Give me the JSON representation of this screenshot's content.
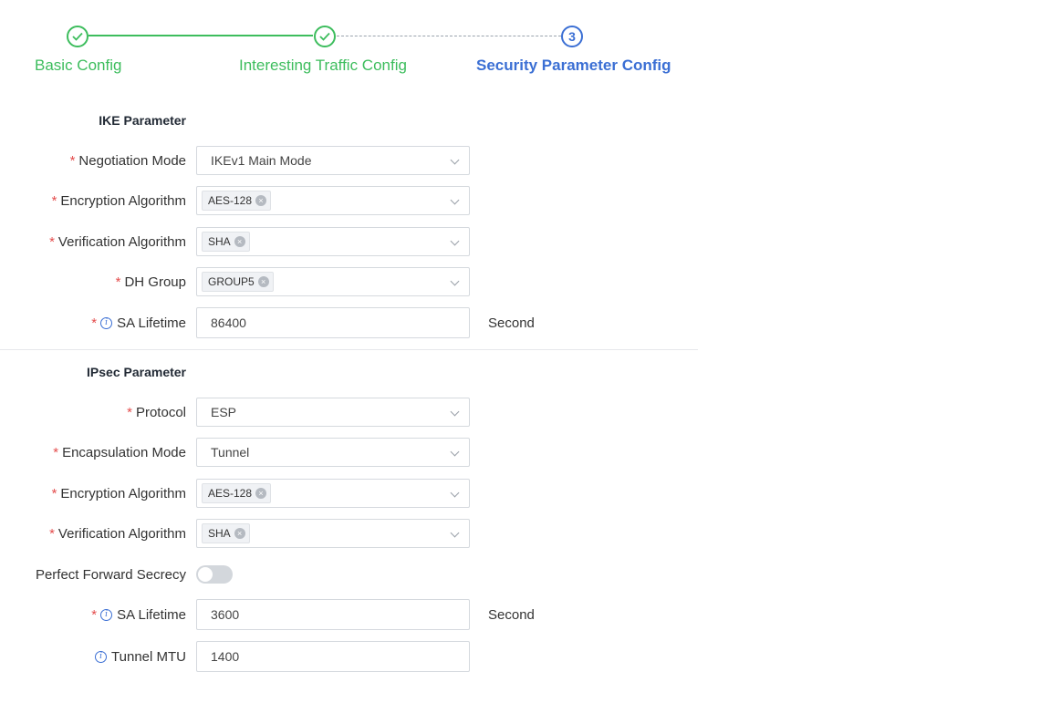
{
  "stepper": {
    "steps": [
      {
        "label": "Basic Config",
        "state": "done"
      },
      {
        "label": "Interesting Traffic Config",
        "state": "done"
      },
      {
        "label": "Security Parameter Config",
        "state": "active",
        "number": "3"
      }
    ]
  },
  "ike": {
    "title": "IKE Parameter",
    "negotiation_mode": {
      "label": "Negotiation Mode",
      "value": "IKEv1 Main Mode"
    },
    "encryption": {
      "label": "Encryption Algorithm",
      "tag": "AES-128"
    },
    "verification": {
      "label": "Verification Algorithm",
      "tag": "SHA"
    },
    "dh_group": {
      "label": "DH Group",
      "tag": "GROUP5"
    },
    "sa_lifetime": {
      "label": "SA Lifetime",
      "value": "86400",
      "unit": "Second"
    }
  },
  "ipsec": {
    "title": "IPsec Parameter",
    "protocol": {
      "label": "Protocol",
      "value": "ESP"
    },
    "encapsulation": {
      "label": "Encapsulation Mode",
      "value": "Tunnel"
    },
    "encryption": {
      "label": "Encryption Algorithm",
      "tag": "AES-128"
    },
    "verification": {
      "label": "Verification Algorithm",
      "tag": "SHA"
    },
    "pfs": {
      "label": "Perfect Forward Secrecy",
      "enabled": false
    },
    "sa_lifetime": {
      "label": "SA Lifetime",
      "value": "3600",
      "unit": "Second"
    },
    "tunnel_mtu": {
      "label": "Tunnel MTU",
      "value": "1400"
    }
  },
  "colors": {
    "done": "#3dbd5d",
    "active": "#3b6fd4",
    "required": "#e44d4d"
  },
  "icons": {
    "done_step": "check-icon",
    "info": "info-icon",
    "dropdown": "chevron-down-icon",
    "tag_remove": "close-icon"
  }
}
